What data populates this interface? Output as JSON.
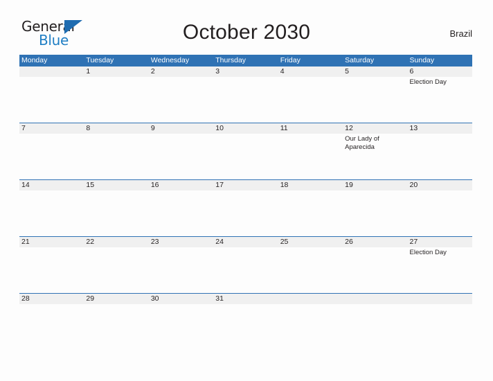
{
  "brand": {
    "name_part1": "General",
    "name_part2": "Blue",
    "color_dark": "#231f20",
    "color_blue": "#1f7ec4"
  },
  "header": {
    "title": "October 2030",
    "region": "Brazil"
  },
  "theme": {
    "header_blue": "#2f72b4",
    "band_gray": "#f0f0f0",
    "page_background": "#fdfdfd",
    "text": "#231f20"
  },
  "calendar": {
    "month": "October",
    "year": "2030",
    "weekday_headers": [
      "Monday",
      "Tuesday",
      "Wednesday",
      "Thursday",
      "Friday",
      "Saturday",
      "Sunday"
    ],
    "weeks": [
      {
        "days": [
          {
            "number": "",
            "events": []
          },
          {
            "number": "1",
            "events": []
          },
          {
            "number": "2",
            "events": []
          },
          {
            "number": "3",
            "events": []
          },
          {
            "number": "4",
            "events": []
          },
          {
            "number": "5",
            "events": []
          },
          {
            "number": "6",
            "events": [
              "Election Day"
            ]
          }
        ]
      },
      {
        "days": [
          {
            "number": "7",
            "events": []
          },
          {
            "number": "8",
            "events": []
          },
          {
            "number": "9",
            "events": []
          },
          {
            "number": "10",
            "events": []
          },
          {
            "number": "11",
            "events": []
          },
          {
            "number": "12",
            "events": [
              "Our Lady of Aparecida"
            ]
          },
          {
            "number": "13",
            "events": []
          }
        ]
      },
      {
        "days": [
          {
            "number": "14",
            "events": []
          },
          {
            "number": "15",
            "events": []
          },
          {
            "number": "16",
            "events": []
          },
          {
            "number": "17",
            "events": []
          },
          {
            "number": "18",
            "events": []
          },
          {
            "number": "19",
            "events": []
          },
          {
            "number": "20",
            "events": []
          }
        ]
      },
      {
        "days": [
          {
            "number": "21",
            "events": []
          },
          {
            "number": "22",
            "events": []
          },
          {
            "number": "23",
            "events": []
          },
          {
            "number": "24",
            "events": []
          },
          {
            "number": "25",
            "events": []
          },
          {
            "number": "26",
            "events": []
          },
          {
            "number": "27",
            "events": [
              "Election Day"
            ]
          }
        ]
      },
      {
        "days": [
          {
            "number": "28",
            "events": []
          },
          {
            "number": "29",
            "events": []
          },
          {
            "number": "30",
            "events": []
          },
          {
            "number": "31",
            "events": []
          },
          {
            "number": "",
            "events": []
          },
          {
            "number": "",
            "events": []
          },
          {
            "number": "",
            "events": []
          }
        ]
      }
    ]
  }
}
